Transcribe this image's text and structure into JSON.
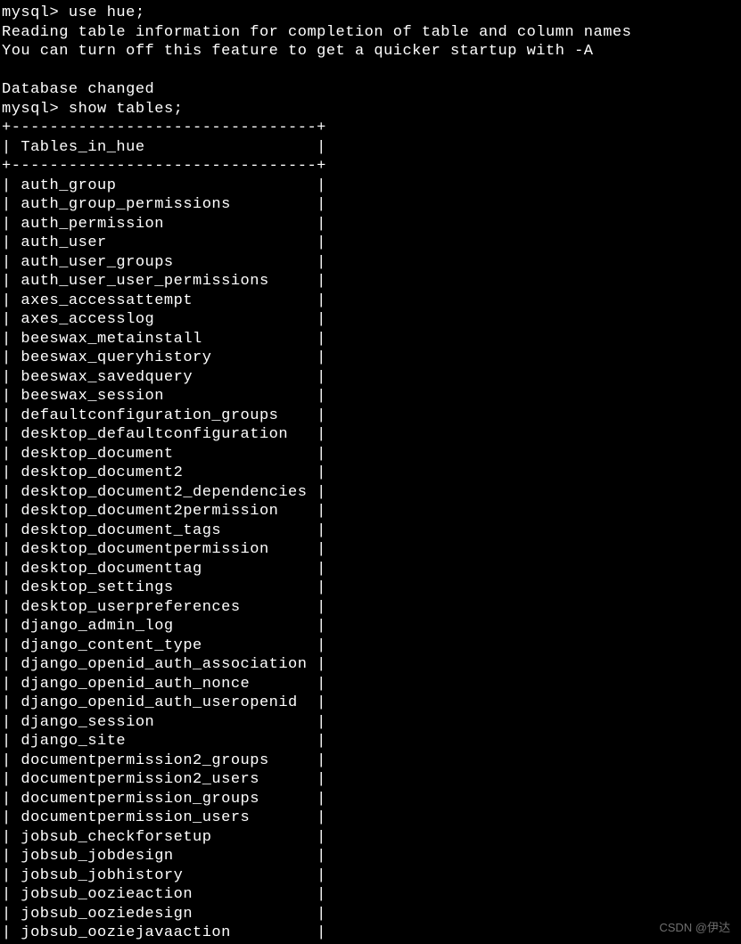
{
  "terminal": {
    "prompt": "mysql>",
    "command1": "use hue;",
    "line1": "Reading table information for completion of table and column names",
    "line2": "You can turn off this feature to get a quicker startup with -A",
    "line3": "Database changed",
    "command2": "show tables;",
    "table_header": "Tables_in_hue",
    "border_top": "+--------------------------------+",
    "tables": [
      "auth_group",
      "auth_group_permissions",
      "auth_permission",
      "auth_user",
      "auth_user_groups",
      "auth_user_user_permissions",
      "axes_accessattempt",
      "axes_accesslog",
      "beeswax_metainstall",
      "beeswax_queryhistory",
      "beeswax_savedquery",
      "beeswax_session",
      "defaultconfiguration_groups",
      "desktop_defaultconfiguration",
      "desktop_document",
      "desktop_document2",
      "desktop_document2_dependencies",
      "desktop_document2permission",
      "desktop_document_tags",
      "desktop_documentpermission",
      "desktop_documenttag",
      "desktop_settings",
      "desktop_userpreferences",
      "django_admin_log",
      "django_content_type",
      "django_openid_auth_association",
      "django_openid_auth_nonce",
      "django_openid_auth_useropenid",
      "django_session",
      "django_site",
      "documentpermission2_groups",
      "documentpermission2_users",
      "documentpermission_groups",
      "documentpermission_users",
      "jobsub_checkforsetup",
      "jobsub_jobdesign",
      "jobsub_jobhistory",
      "jobsub_oozieaction",
      "jobsub_ooziedesign",
      "jobsub_ooziejavaaction"
    ]
  },
  "watermark": "CSDN @伊达"
}
